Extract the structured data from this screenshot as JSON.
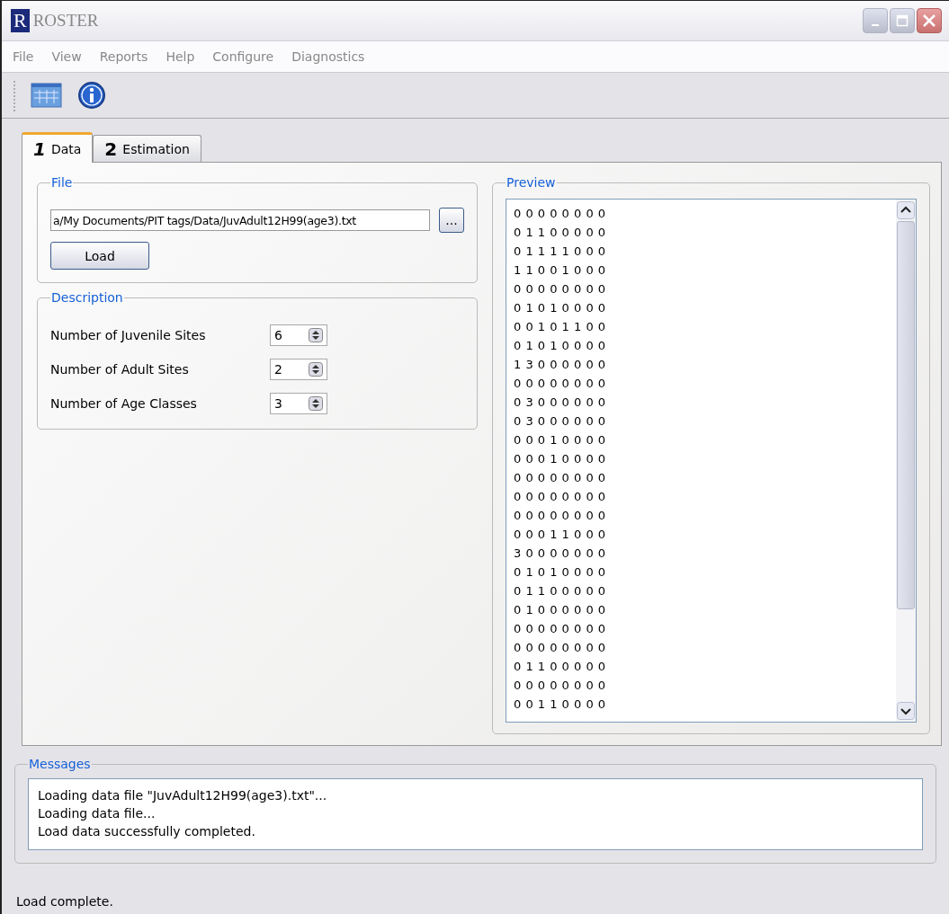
{
  "window": {
    "logo": "R",
    "title": "ROSTER"
  },
  "menu": [
    "File",
    "View",
    "Reports",
    "Help",
    "Configure",
    "Diagnostics"
  ],
  "tabs": [
    {
      "number": "1",
      "label": "Data",
      "selected": true
    },
    {
      "number": "2",
      "label": "Estimation",
      "selected": false
    }
  ],
  "file_group": {
    "title": "File",
    "path": "a/My Documents/PIT tags/Data/JuvAdult12H99(age3).txt",
    "browse_button": "...",
    "load_button": "Load"
  },
  "description_group": {
    "title": "Description",
    "fields": [
      {
        "label": "Number of Juvenile Sites",
        "value": "6"
      },
      {
        "label": "Number of Adult Sites",
        "value": "2"
      },
      {
        "label": "Number of Age Classes",
        "value": "3"
      }
    ]
  },
  "preview": {
    "title": "Preview",
    "lines": [
      "0 0 0 0 0 0 0 0",
      "0 1 1 0 0 0 0 0",
      "0 1 1 1 1 0 0 0",
      "1 1 0 0 1 0 0 0",
      "0 0 0 0 0 0 0 0",
      "0 1 0 1 0 0 0 0",
      "0 0 1 0 1 1 0 0",
      "0 1 0 1 0 0 0 0",
      "1 3 0 0 0 0 0 0",
      "0 0 0 0 0 0 0 0",
      "0 3 0 0 0 0 0 0",
      "0 3 0 0 0 0 0 0",
      "0 0 0 1 0 0 0 0",
      "0 0 0 1 0 0 0 0",
      "0 0 0 0 0 0 0 0",
      "0 0 0 0 0 0 0 0",
      "0 0 0 0 0 0 0 0",
      "0 0 0 1 1 0 0 0",
      "3 0 0 0 0 0 0 0",
      "0 1 0 1 0 0 0 0",
      "0 1 1 0 0 0 0 0",
      "0 1 0 0 0 0 0 0",
      "0 0 0 0 0 0 0 0",
      "0 0 0 0 0 0 0 0",
      "0 1 1 0 0 0 0 0",
      "0 0 0 0 0 0 0 0",
      "0 0 1 1 0 0 0 0"
    ]
  },
  "messages": {
    "title": "Messages",
    "lines": [
      "Loading data file \"JuvAdult12H99(age3).txt\"...",
      "Loading data file...",
      "Load data successfully completed."
    ]
  },
  "status_bar": "Load complete."
}
